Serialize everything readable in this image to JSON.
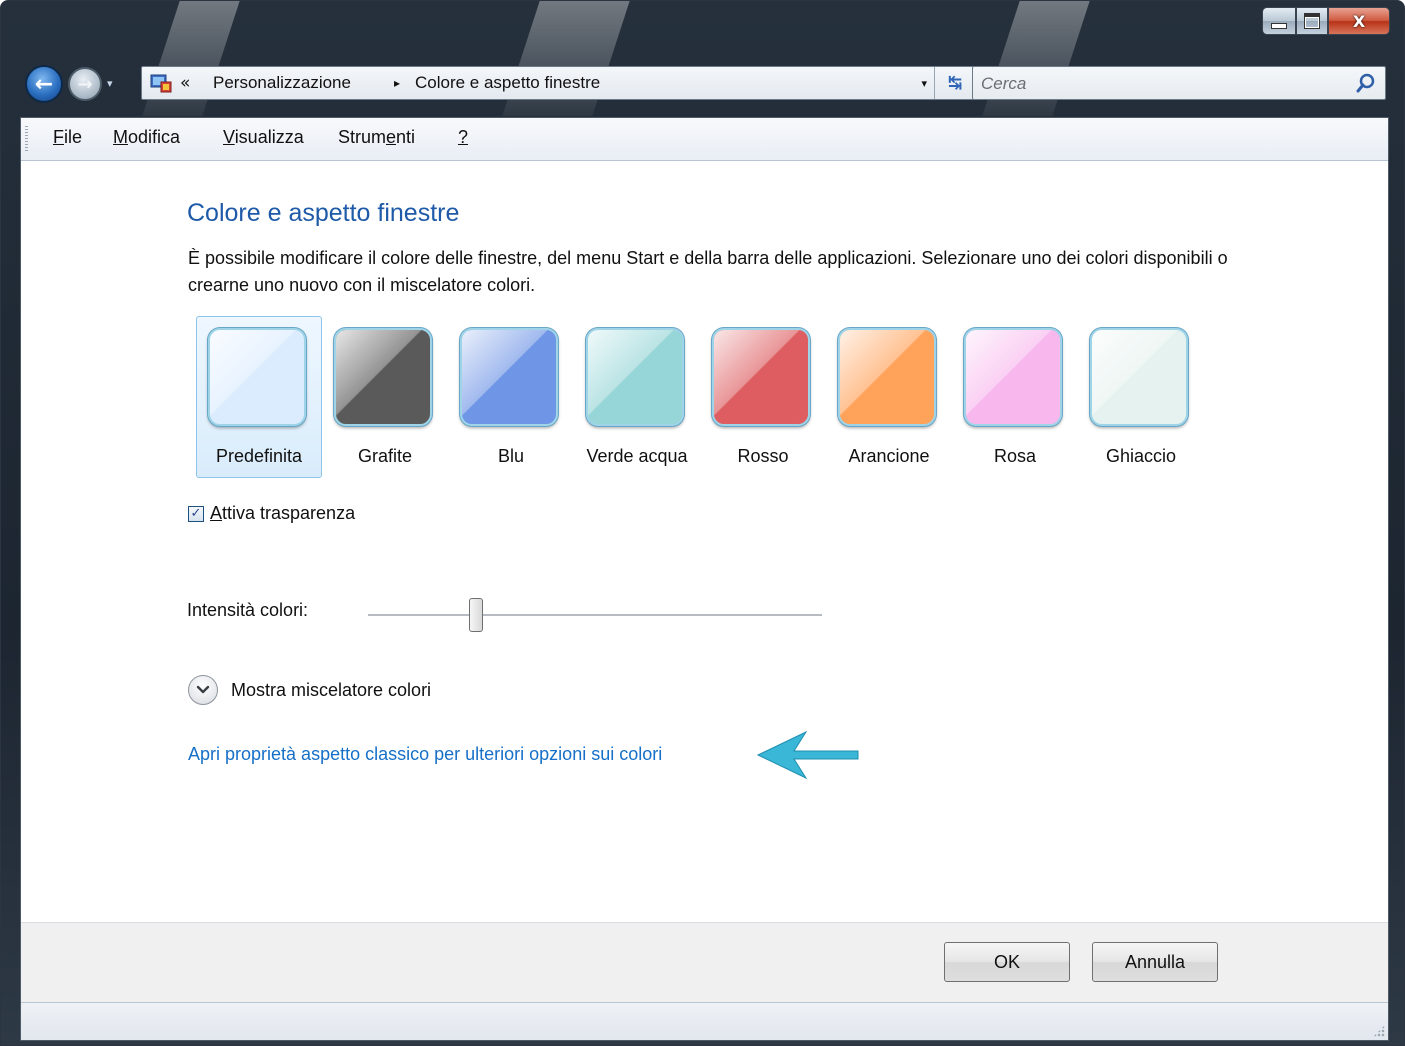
{
  "window": {
    "caption_buttons": {
      "minimize_icon": "minimize-icon",
      "maximize_icon": "maximize-icon",
      "close_glyph": "X"
    }
  },
  "navigation": {
    "back_glyph": "←",
    "forward_glyph": "→",
    "history_glyph": "▾",
    "address": {
      "chevrons": "«",
      "breadcrumbs": [
        "Personalizzazione",
        "Colore e aspetto finestre"
      ],
      "separator": "▸",
      "dropdown_glyph": "▾",
      "refresh_glyph": "↹"
    },
    "search": {
      "placeholder": "Cerca"
    }
  },
  "menu": {
    "items": [
      {
        "mnemonic": "F",
        "rest": "ile"
      },
      {
        "mnemonic": "M",
        "rest": "odifica"
      },
      {
        "mnemonic": "V",
        "rest": "isualizza"
      },
      {
        "pre": "Strum",
        "mnemonic": "e",
        "rest": "nti"
      },
      {
        "mnemonic": "?",
        "rest": ""
      }
    ]
  },
  "content": {
    "title": "Colore e aspetto finestre",
    "description": "È possibile modificare il colore delle finestre, del menu Start e della barra delle applicazioni. Selezionare uno dei colori disponibili o crearne uno nuovo con il miscelatore colori.",
    "swatches": [
      {
        "label": "Predefinita",
        "color": "#dcecff",
        "selected": true
      },
      {
        "label": "Grafite",
        "color": "#5a5a5a",
        "selected": false
      },
      {
        "label": "Blu",
        "color": "#6f95e6",
        "selected": false
      },
      {
        "label": "Verde acqua",
        "color": "#97d6d8",
        "selected": false
      },
      {
        "label": "Rosso",
        "color": "#dd5d60",
        "selected": false
      },
      {
        "label": "Arancione",
        "color": "#ffa25a",
        "selected": false
      },
      {
        "label": "Rosa",
        "color": "#f8b8ee",
        "selected": false
      },
      {
        "label": "Ghiaccio",
        "color": "#e6f2ef",
        "selected": false
      }
    ],
    "transparency": {
      "checked": true,
      "check_glyph": "✓",
      "mnemonic": "A",
      "rest": "ttiva trasparenza"
    },
    "intensity": {
      "label": "Intensità colori:",
      "value_fraction": 0.23
    },
    "mixer_toggle": {
      "label": "Mostra miscelatore colori",
      "icon": "chevron-down-icon"
    },
    "classic_link": "Apri proprietà aspetto classico per ulteriori opzioni sui colori",
    "annotation_arrow_color": "#3ab6d6"
  },
  "footer": {
    "ok_label": "OK",
    "cancel_label": "Annulla"
  }
}
